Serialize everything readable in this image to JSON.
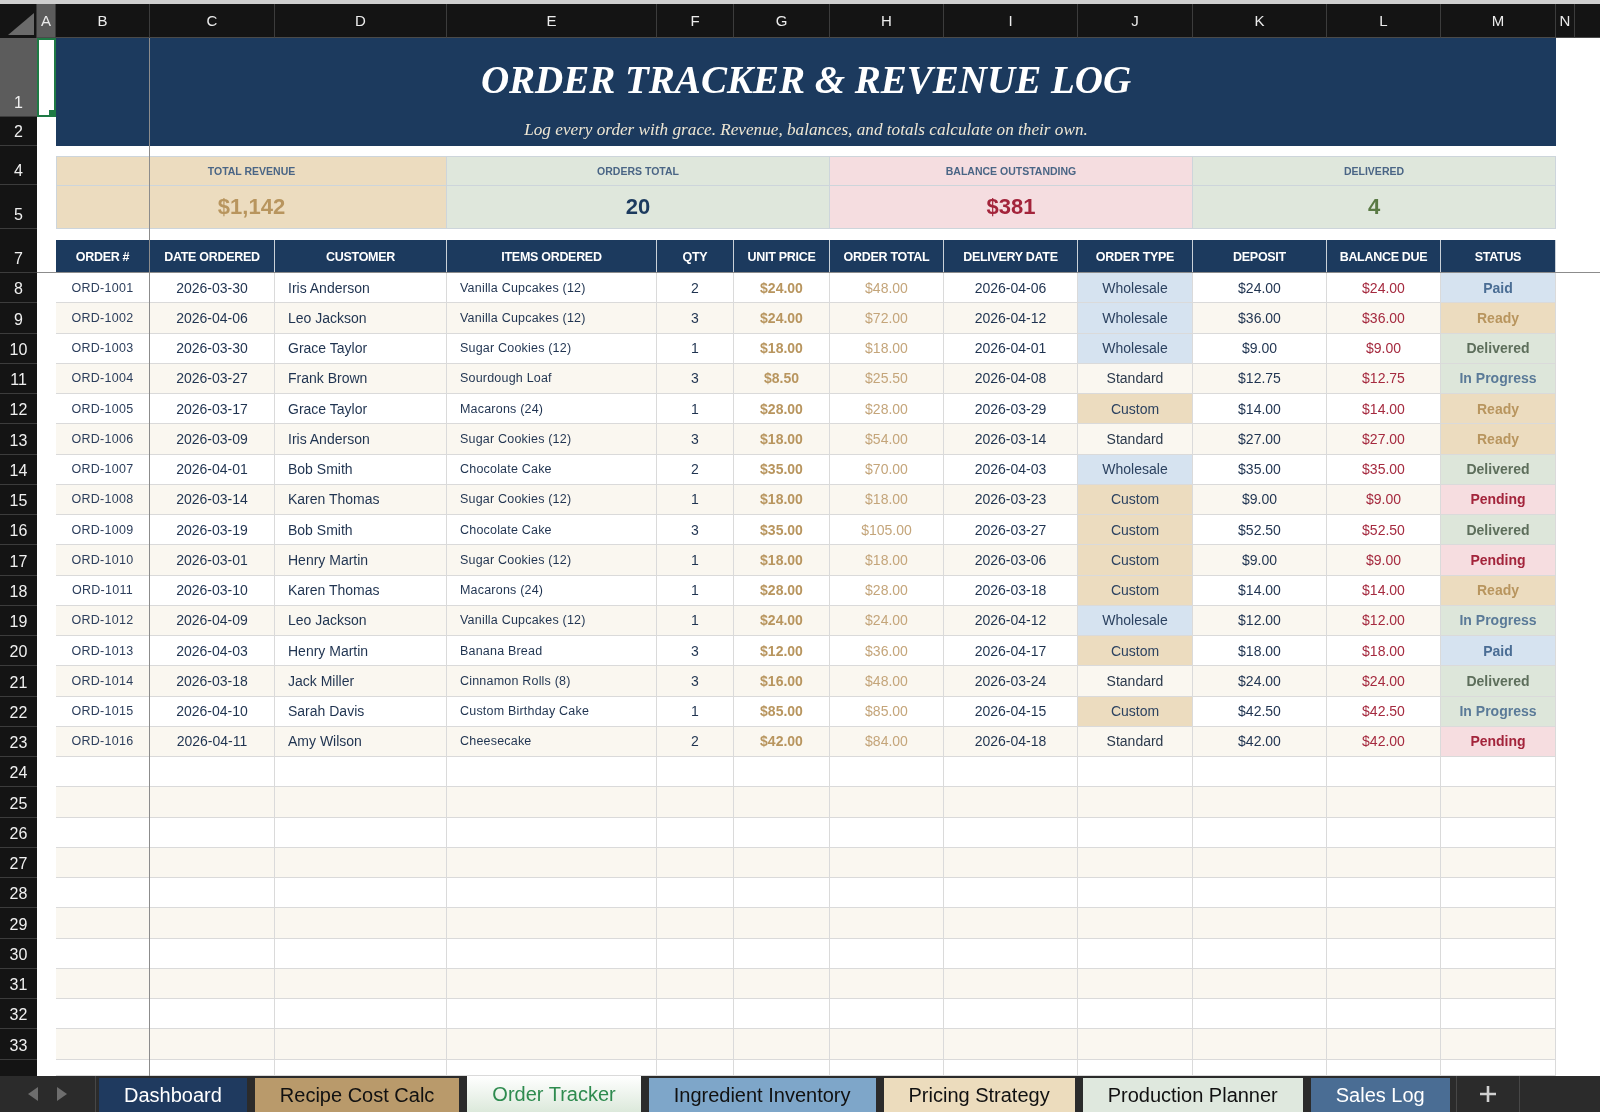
{
  "column_letters": [
    {
      "label": "A",
      "selected": true
    },
    {
      "label": "B",
      "selected": false
    },
    {
      "label": "C",
      "selected": false
    },
    {
      "label": "D",
      "selected": false
    },
    {
      "label": "E",
      "selected": false
    },
    {
      "label": "F",
      "selected": false
    },
    {
      "label": "G",
      "selected": false
    },
    {
      "label": "H",
      "selected": false
    },
    {
      "label": "I",
      "selected": false
    },
    {
      "label": "J",
      "selected": false
    },
    {
      "label": "K",
      "selected": false
    },
    {
      "label": "L",
      "selected": false
    },
    {
      "label": "M",
      "selected": false
    },
    {
      "label": "N",
      "selected": false
    }
  ],
  "row_numbers": [
    {
      "label": "1",
      "selected": true
    },
    {
      "label": "2",
      "selected": false
    },
    {
      "label": "4",
      "selected": false
    },
    {
      "label": "5",
      "selected": false
    },
    {
      "label": "7",
      "selected": false
    },
    {
      "label": "8",
      "selected": false
    },
    {
      "label": "9",
      "selected": false
    },
    {
      "label": "10",
      "selected": false
    },
    {
      "label": "11",
      "selected": false
    },
    {
      "label": "12",
      "selected": false
    },
    {
      "label": "13",
      "selected": false
    },
    {
      "label": "14",
      "selected": false
    },
    {
      "label": "15",
      "selected": false
    },
    {
      "label": "16",
      "selected": false
    },
    {
      "label": "17",
      "selected": false
    },
    {
      "label": "18",
      "selected": false
    },
    {
      "label": "19",
      "selected": false
    },
    {
      "label": "20",
      "selected": false
    },
    {
      "label": "21",
      "selected": false
    },
    {
      "label": "22",
      "selected": false
    },
    {
      "label": "23",
      "selected": false
    },
    {
      "label": "24",
      "selected": false
    },
    {
      "label": "25",
      "selected": false
    },
    {
      "label": "26",
      "selected": false
    },
    {
      "label": "27",
      "selected": false
    },
    {
      "label": "28",
      "selected": false
    },
    {
      "label": "29",
      "selected": false
    },
    {
      "label": "30",
      "selected": false
    },
    {
      "label": "31",
      "selected": false
    },
    {
      "label": "32",
      "selected": false
    },
    {
      "label": "33",
      "selected": false
    }
  ],
  "title_band": {
    "title": "ORDER TRACKER & REVENUE LOG",
    "subtitle": "Log every order with grace. Revenue, balances, and totals calculate on their own."
  },
  "summary": [
    {
      "label": "TOTAL REVENUE",
      "value": "$1,142",
      "kind": "revenue"
    },
    {
      "label": "ORDERS TOTAL",
      "value": "20",
      "kind": "orders"
    },
    {
      "label": "BALANCE OUTSTANDING",
      "value": "$381",
      "kind": "balance"
    },
    {
      "label": "DELIVERED",
      "value": "4",
      "kind": "delivered"
    }
  ],
  "table": {
    "columns": [
      "ORDER #",
      "DATE ORDERED",
      "CUSTOMER",
      "ITEMS ORDERED",
      "QTY",
      "UNIT PRICE",
      "ORDER TOTAL",
      "DELIVERY DATE",
      "ORDER TYPE",
      "DEPOSIT",
      "BALANCE DUE",
      "STATUS"
    ],
    "rows": [
      {
        "order": "ORD-1001",
        "date_ordered": "2026-03-30",
        "customer": "Iris Anderson",
        "items_ordered": "Vanilla Cupcakes (12)",
        "qty": "2",
        "unit_price": "$24.00",
        "order_total": "$48.00",
        "delivery_date": "2026-04-06",
        "order_type": {
          "label": "Wholesale",
          "kind": "wholesale"
        },
        "deposit": "$24.00",
        "balance_due": "$24.00",
        "status": {
          "label": "Paid",
          "kind": "paid"
        }
      },
      {
        "order": "ORD-1002",
        "date_ordered": "2026-04-06",
        "customer": "Leo Jackson",
        "items_ordered": "Vanilla Cupcakes (12)",
        "qty": "3",
        "unit_price": "$24.00",
        "order_total": "$72.00",
        "delivery_date": "2026-04-12",
        "order_type": {
          "label": "Wholesale",
          "kind": "wholesale"
        },
        "deposit": "$36.00",
        "balance_due": "$36.00",
        "status": {
          "label": "Ready",
          "kind": "ready"
        }
      },
      {
        "order": "ORD-1003",
        "date_ordered": "2026-03-30",
        "customer": "Grace Taylor",
        "items_ordered": "Sugar Cookies (12)",
        "qty": "1",
        "unit_price": "$18.00",
        "order_total": "$18.00",
        "delivery_date": "2026-04-01",
        "order_type": {
          "label": "Wholesale",
          "kind": "wholesale"
        },
        "deposit": "$9.00",
        "balance_due": "$9.00",
        "status": {
          "label": "Delivered",
          "kind": "delivered"
        }
      },
      {
        "order": "ORD-1004",
        "date_ordered": "2026-03-27",
        "customer": "Frank Brown",
        "items_ordered": "Sourdough Loaf",
        "qty": "3",
        "unit_price": "$8.50",
        "order_total": "$25.50",
        "delivery_date": "2026-04-08",
        "order_type": {
          "label": "Standard",
          "kind": "standard"
        },
        "deposit": "$12.75",
        "balance_due": "$12.75",
        "status": {
          "label": "In Progress",
          "kind": "in_progress"
        }
      },
      {
        "order": "ORD-1005",
        "date_ordered": "2026-03-17",
        "customer": "Grace Taylor",
        "items_ordered": "Macarons (24)",
        "qty": "1",
        "unit_price": "$28.00",
        "order_total": "$28.00",
        "delivery_date": "2026-03-29",
        "order_type": {
          "label": "Custom",
          "kind": "custom"
        },
        "deposit": "$14.00",
        "balance_due": "$14.00",
        "status": {
          "label": "Ready",
          "kind": "ready"
        }
      },
      {
        "order": "ORD-1006",
        "date_ordered": "2026-03-09",
        "customer": "Iris Anderson",
        "items_ordered": "Sugar Cookies (12)",
        "qty": "3",
        "unit_price": "$18.00",
        "order_total": "$54.00",
        "delivery_date": "2026-03-14",
        "order_type": {
          "label": "Standard",
          "kind": "standard"
        },
        "deposit": "$27.00",
        "balance_due": "$27.00",
        "status": {
          "label": "Ready",
          "kind": "ready"
        }
      },
      {
        "order": "ORD-1007",
        "date_ordered": "2026-04-01",
        "customer": "Bob Smith",
        "items_ordered": "Chocolate Cake",
        "qty": "2",
        "unit_price": "$35.00",
        "order_total": "$70.00",
        "delivery_date": "2026-04-03",
        "order_type": {
          "label": "Wholesale",
          "kind": "wholesale"
        },
        "deposit": "$35.00",
        "balance_due": "$35.00",
        "status": {
          "label": "Delivered",
          "kind": "delivered"
        }
      },
      {
        "order": "ORD-1008",
        "date_ordered": "2026-03-14",
        "customer": "Karen Thomas",
        "items_ordered": "Sugar Cookies (12)",
        "qty": "1",
        "unit_price": "$18.00",
        "order_total": "$18.00",
        "delivery_date": "2026-03-23",
        "order_type": {
          "label": "Custom",
          "kind": "custom"
        },
        "deposit": "$9.00",
        "balance_due": "$9.00",
        "status": {
          "label": "Pending",
          "kind": "pending"
        }
      },
      {
        "order": "ORD-1009",
        "date_ordered": "2026-03-19",
        "customer": "Bob Smith",
        "items_ordered": "Chocolate Cake",
        "qty": "3",
        "unit_price": "$35.00",
        "order_total": "$105.00",
        "delivery_date": "2026-03-27",
        "order_type": {
          "label": "Custom",
          "kind": "custom"
        },
        "deposit": "$52.50",
        "balance_due": "$52.50",
        "status": {
          "label": "Delivered",
          "kind": "delivered"
        }
      },
      {
        "order": "ORD-1010",
        "date_ordered": "2026-03-01",
        "customer": "Henry Martin",
        "items_ordered": "Sugar Cookies (12)",
        "qty": "1",
        "unit_price": "$18.00",
        "order_total": "$18.00",
        "delivery_date": "2026-03-06",
        "order_type": {
          "label": "Custom",
          "kind": "custom"
        },
        "deposit": "$9.00",
        "balance_due": "$9.00",
        "status": {
          "label": "Pending",
          "kind": "pending"
        }
      },
      {
        "order": "ORD-1011",
        "date_ordered": "2026-03-10",
        "customer": "Karen Thomas",
        "items_ordered": "Macarons (24)",
        "qty": "1",
        "unit_price": "$28.00",
        "order_total": "$28.00",
        "delivery_date": "2026-03-18",
        "order_type": {
          "label": "Custom",
          "kind": "custom"
        },
        "deposit": "$14.00",
        "balance_due": "$14.00",
        "status": {
          "label": "Ready",
          "kind": "ready"
        }
      },
      {
        "order": "ORD-1012",
        "date_ordered": "2026-04-09",
        "customer": "Leo Jackson",
        "items_ordered": "Vanilla Cupcakes (12)",
        "qty": "1",
        "unit_price": "$24.00",
        "order_total": "$24.00",
        "delivery_date": "2026-04-12",
        "order_type": {
          "label": "Wholesale",
          "kind": "wholesale"
        },
        "deposit": "$12.00",
        "balance_due": "$12.00",
        "status": {
          "label": "In Progress",
          "kind": "in_progress"
        }
      },
      {
        "order": "ORD-1013",
        "date_ordered": "2026-04-03",
        "customer": "Henry Martin",
        "items_ordered": "Banana Bread",
        "qty": "3",
        "unit_price": "$12.00",
        "order_total": "$36.00",
        "delivery_date": "2026-04-17",
        "order_type": {
          "label": "Custom",
          "kind": "custom"
        },
        "deposit": "$18.00",
        "balance_due": "$18.00",
        "status": {
          "label": "Paid",
          "kind": "paid"
        }
      },
      {
        "order": "ORD-1014",
        "date_ordered": "2026-03-18",
        "customer": "Jack Miller",
        "items_ordered": "Cinnamon Rolls (8)",
        "qty": "3",
        "unit_price": "$16.00",
        "order_total": "$48.00",
        "delivery_date": "2026-03-24",
        "order_type": {
          "label": "Standard",
          "kind": "standard"
        },
        "deposit": "$24.00",
        "balance_due": "$24.00",
        "status": {
          "label": "Delivered",
          "kind": "delivered"
        }
      },
      {
        "order": "ORD-1015",
        "date_ordered": "2026-04-10",
        "customer": "Sarah Davis",
        "items_ordered": "Custom Birthday Cake",
        "qty": "1",
        "unit_price": "$85.00",
        "order_total": "$85.00",
        "delivery_date": "2026-04-15",
        "order_type": {
          "label": "Custom",
          "kind": "custom"
        },
        "deposit": "$42.50",
        "balance_due": "$42.50",
        "status": {
          "label": "In Progress",
          "kind": "in_progress"
        }
      },
      {
        "order": "ORD-1016",
        "date_ordered": "2026-04-11",
        "customer": "Amy Wilson",
        "items_ordered": "Cheesecake",
        "qty": "2",
        "unit_price": "$42.00",
        "order_total": "$84.00",
        "delivery_date": "2026-04-18",
        "order_type": {
          "label": "Standard",
          "kind": "standard"
        },
        "deposit": "$42.00",
        "balance_due": "$42.00",
        "status": {
          "label": "Pending",
          "kind": "pending"
        }
      }
    ]
  },
  "sheet_tabs": [
    {
      "label": "Dashboard",
      "color": "#1f3a5f",
      "selected": false
    },
    {
      "label": "Recipe Cost Calc",
      "color": "#b99a6b",
      "selected": false
    },
    {
      "label": "Order Tracker",
      "color": "#dce9db",
      "selected": true
    },
    {
      "label": "Ingredient Inventory",
      "color": "#7ea6c9",
      "selected": false
    },
    {
      "label": "Pricing Strategy",
      "color": "#ecdcbd",
      "selected": false
    },
    {
      "label": "Production Planner",
      "color": "#dfe8de",
      "selected": false
    },
    {
      "label": "Sales Log",
      "color": "#4a6d94",
      "selected": false
    }
  ]
}
